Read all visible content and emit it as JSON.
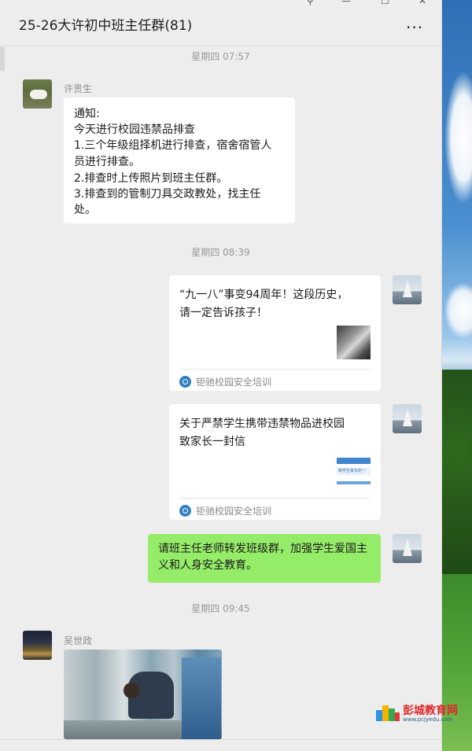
{
  "chat": {
    "title": "25-26大许初中班主任群(81)",
    "more_label": "..."
  },
  "window_controls": {
    "pin": "⚲",
    "minimize": "—",
    "maximize": "☐",
    "close": "✕"
  },
  "messages": [
    {
      "type": "time",
      "text": "星期四 07:57"
    },
    {
      "type": "text",
      "sender": "许贵生",
      "avatar": "goat-avatar",
      "lines": [
        "通知:",
        " 今天进行校园违禁品排查",
        "1.三个年级组择机进行排查，宿舍宿管人",
        "员进行排查。",
        "2.排查时上传照片到班主任群。",
        "3.排查到的管制刀具交政教处，找主任",
        "处。"
      ]
    },
    {
      "type": "time",
      "text": "星期四 08:39"
    },
    {
      "type": "link",
      "from_me": true,
      "title": "“九一八”事变94周年！这段历史，请一定告诉孩子！",
      "source": "钜驰校园安全培训",
      "thumb": "historical-photo-thumbnail"
    },
    {
      "type": "link",
      "from_me": true,
      "title": "关于严禁学生携带违禁物品进校园致家长一封信",
      "source": "钜驰校园安全培训",
      "thumb": "document-thumbnail",
      "thumb_text": "致学生家长的一"
    },
    {
      "type": "text",
      "from_me": true,
      "text": "请班主任老师转发班级群，加强学生爱国主义和人身安全教育。"
    },
    {
      "type": "time",
      "text": "星期四 09:45"
    },
    {
      "type": "image",
      "sender": "吴世政",
      "avatar": "night-city-avatar",
      "image": "dormitory-inspection-photo"
    }
  ],
  "watermark": {
    "title": "彭城教育网",
    "url": "www.pcjyedu.com"
  },
  "colors": {
    "sent_bubble": "#95ec69",
    "window_bg": "#ededed",
    "bubble_bg": "#ffffff"
  }
}
